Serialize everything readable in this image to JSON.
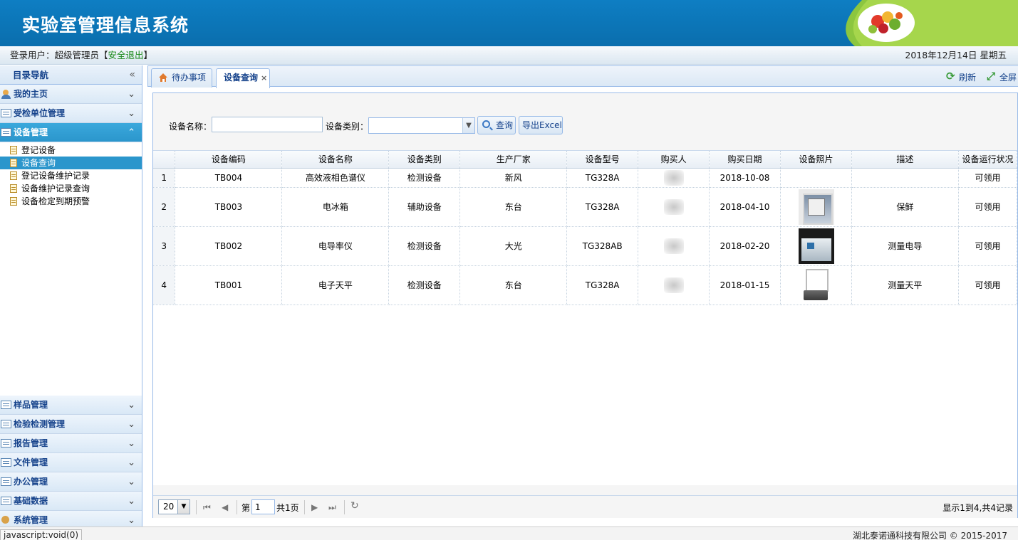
{
  "header": {
    "title": "实验室管理信息系统"
  },
  "topbar": {
    "login_prefix": "登录用户：超级管理员【",
    "logout": "安全退出",
    "login_suffix": "】",
    "date": "2018年12月14日 星期五"
  },
  "sidebar": {
    "title": "目录导航",
    "menus": [
      {
        "label": "我的主页",
        "icon": "user-icon"
      },
      {
        "label": "受检单位管理",
        "icon": "list-icon"
      },
      {
        "label": "设备管理",
        "icon": "list-icon",
        "expanded": true
      },
      {
        "label": "样品管理",
        "icon": "list-icon"
      },
      {
        "label": "检验检测管理",
        "icon": "list-icon"
      },
      {
        "label": "报告管理",
        "icon": "list-icon"
      },
      {
        "label": "文件管理",
        "icon": "list-icon"
      },
      {
        "label": "办公管理",
        "icon": "list-icon"
      },
      {
        "label": "基础数据",
        "icon": "list-icon"
      },
      {
        "label": "系统管理",
        "icon": "gear-icon"
      }
    ],
    "device_items": [
      "登记设备",
      "设备查询",
      "登记设备维护记录",
      "设备维护记录查询",
      "设备检定到期预警"
    ]
  },
  "tabs": {
    "home": "待办事项",
    "query": "设备查询",
    "close": "×",
    "refresh": "刷新",
    "fullscreen": "全屏"
  },
  "search": {
    "name_label": "设备名称：",
    "name_value": "",
    "type_label": "设备类别：",
    "type_value": "",
    "search_btn": "查询",
    "export_btn": "导出Excel"
  },
  "grid": {
    "columns": [
      "设备编码",
      "设备名称",
      "设备类别",
      "生产厂家",
      "设备型号",
      "购买人",
      "购买日期",
      "设备照片",
      "描述",
      "设备运行状况"
    ],
    "rows": [
      {
        "num": "1",
        "code": "TB004",
        "name": "高效液相色谱仪",
        "category": "检测设备",
        "maker": "新风",
        "model": "TG328A",
        "date": "2018-10-08",
        "desc": "",
        "status": "可领用"
      },
      {
        "num": "2",
        "code": "TB003",
        "name": "电冰箱",
        "category": "辅助设备",
        "maker": "东台",
        "model": "TG328A",
        "date": "2018-04-10",
        "desc": "保鲜",
        "status": "可领用"
      },
      {
        "num": "3",
        "code": "TB002",
        "name": "电导率仪",
        "category": "检测设备",
        "maker": "大光",
        "model": "TG328AB",
        "date": "2018-02-20",
        "desc": "测量电导",
        "status": "可领用"
      },
      {
        "num": "4",
        "code": "TB001",
        "name": "电子天平",
        "category": "检测设备",
        "maker": "东台",
        "model": "TG328A",
        "date": "2018-01-15",
        "desc": "测量天平",
        "status": "可领用"
      }
    ]
  },
  "pager": {
    "page_size": "20",
    "page_prefix": "第",
    "page_value": "1",
    "page_total": "共1页",
    "record_info": "显示1到4,共4记录"
  },
  "statusbar": {
    "url": "javascript:void(0)",
    "copyright": "湖北泰诺通科技有限公司 © 2015-2017"
  }
}
